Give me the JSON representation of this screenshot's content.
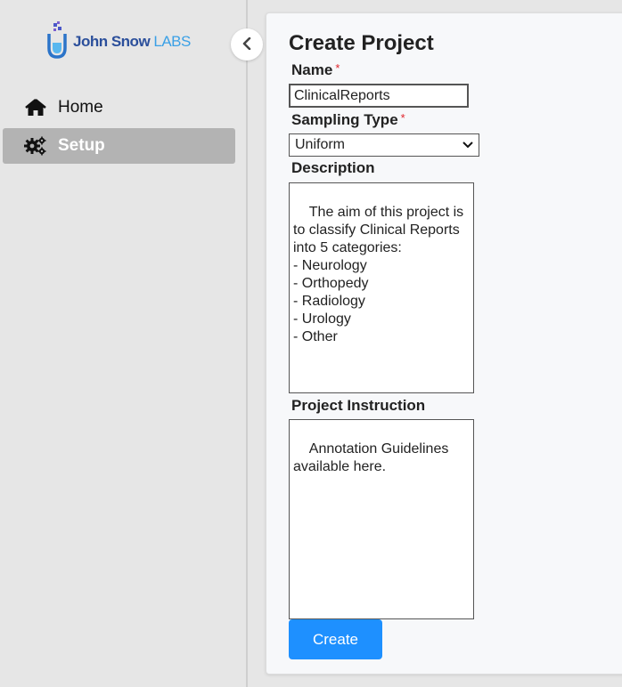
{
  "brand": {
    "name_main": "John Snow ",
    "name_accent": "LABS"
  },
  "sidebar": {
    "items": [
      {
        "label": "Home",
        "icon": "home-icon",
        "active": false
      },
      {
        "label": "Setup",
        "icon": "gears-icon",
        "active": true
      }
    ]
  },
  "form": {
    "title": "Create Project",
    "name": {
      "label": "Name",
      "required_mark": "*",
      "value": "ClinicalReports"
    },
    "sampling": {
      "label": "Sampling Type",
      "required_mark": "*",
      "selected": "Uniform"
    },
    "description": {
      "label": "Description",
      "value": "The aim of this project is to classify Clinical Reports into 5 categories:\n- Neurology\n- Orthopedy\n- Radiology\n- Urology\n- Other"
    },
    "instruction": {
      "label": "Project Instruction",
      "value": "Annotation Guidelines available here."
    },
    "submit_label": "Create"
  },
  "colors": {
    "primary": "#1e90ff",
    "sidebar_bg": "#e6e6e6",
    "active_item_bg": "#b3b3b3",
    "required": "#e0252c"
  }
}
